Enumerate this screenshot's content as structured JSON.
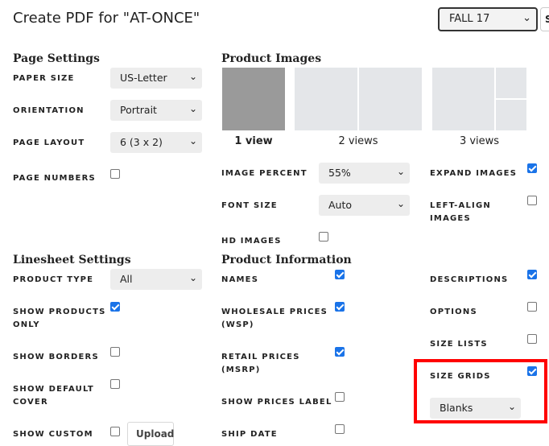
{
  "header": {
    "title": "Create PDF for \"AT-ONCE\"",
    "season_value": "FALL 17",
    "clipped_button_label": "S"
  },
  "page_settings": {
    "heading": "Page Settings",
    "paper_size_label": "PAPER SIZE",
    "paper_size_value": "US-Letter",
    "orientation_label": "ORIENTATION",
    "orientation_value": "Portrait",
    "page_layout_label": "PAGE LAYOUT",
    "page_layout_value": "6 (3 x 2)",
    "page_numbers_label": "PAGE NUMBERS",
    "page_numbers_checked": false
  },
  "product_images": {
    "heading": "Product Images",
    "views": [
      {
        "label": "1 view",
        "selected": true
      },
      {
        "label": "2 views",
        "selected": false
      },
      {
        "label": "3 views",
        "selected": false
      }
    ],
    "image_percent_label": "IMAGE PERCENT",
    "image_percent_value": "55%",
    "font_size_label": "FONT SIZE",
    "font_size_value": "Auto",
    "hd_images_label": "HD IMAGES",
    "hd_images_checked": false,
    "expand_images_label": "EXPAND IMAGES",
    "expand_images_checked": true,
    "left_align_label_1": "LEFT-ALIGN",
    "left_align_label_2": "IMAGES",
    "left_align_checked": false
  },
  "linesheet_settings": {
    "heading": "Linesheet Settings",
    "product_type_label": "PRODUCT TYPE",
    "product_type_value": "All",
    "show_products_only_label_1": "SHOW PRODUCTS",
    "show_products_only_label_2": "ONLY",
    "show_products_only_checked": true,
    "show_borders_label": "SHOW BORDERS",
    "show_borders_checked": false,
    "show_default_cover_label_1": "SHOW DEFAULT",
    "show_default_cover_label_2": "COVER",
    "show_default_cover_checked": false,
    "show_custom_label": "SHOW CUSTOM",
    "show_custom_checked": false,
    "upload_label": "Upload"
  },
  "product_information": {
    "heading": "Product Information",
    "names_label": "NAMES",
    "names_checked": true,
    "wholesale_label_1": "WHOLESALE PRICES",
    "wholesale_label_2": "(WSP)",
    "wholesale_checked": true,
    "retail_label_1": "RETAIL PRICES",
    "retail_label_2": "(MSRP)",
    "retail_checked": true,
    "show_prices_label": "SHOW PRICES LABEL",
    "show_prices_checked": false,
    "ship_date_label": "SHIP DATE",
    "ship_date_checked": false,
    "descriptions_label": "DESCRIPTIONS",
    "descriptions_checked": true,
    "options_label": "OPTIONS",
    "options_checked": false,
    "size_lists_label": "SIZE LISTS",
    "size_lists_checked": false,
    "size_grids_label": "SIZE GRIDS",
    "size_grids_checked": true,
    "size_grids_value": "Blanks"
  },
  "colors": {
    "checkbox_checked": "#1a73e8",
    "highlight": "#ff0000",
    "thumb_selected": "#9a9a9a",
    "thumb": "#e4e6e9"
  }
}
